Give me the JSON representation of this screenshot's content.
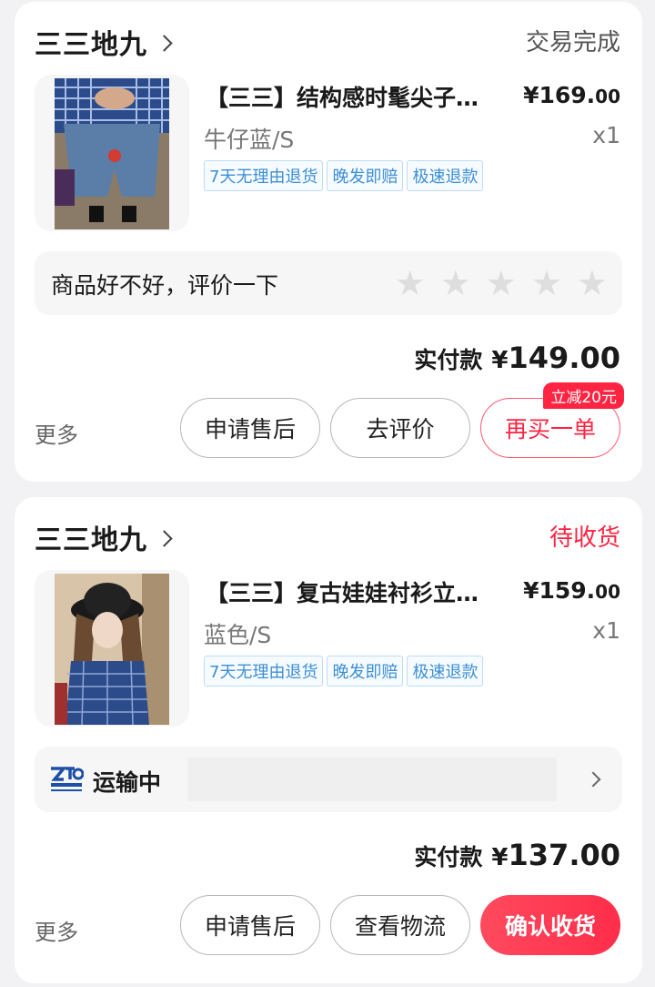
{
  "orders": [
    {
      "shop_name": "三三地九",
      "status": "交易完成",
      "product": {
        "title": "【三三】结构感时髦尖子…",
        "price_main": "¥169.",
        "price_cents": "00",
        "spec": "牛仔蓝/S",
        "qty": "x1",
        "tags": [
          "7天无理由退货",
          "晚发即赔",
          "极速退款"
        ]
      },
      "rating_prompt": "商品好不好，评价一下",
      "rating_stars": 0,
      "paid_label": "实付款",
      "paid_amount": "149.00",
      "more": "更多",
      "buttons": [
        "申请售后",
        "去评价",
        "再买一单"
      ],
      "discount_badge": "立减20元"
    },
    {
      "shop_name": "三三地九",
      "status": "待收货",
      "product": {
        "title": "【三三】复古娃娃衬衫立…",
        "price_main": "¥159.",
        "price_cents": "00",
        "spec": "蓝色/S",
        "qty": "x1",
        "tags": [
          "7天无理由退货",
          "晚发即赔",
          "极速退款"
        ]
      },
      "shipping": {
        "carrier_icon": "zto-express-logo",
        "status": "运输中"
      },
      "paid_label": "实付款",
      "paid_amount": "137.00",
      "more": "更多",
      "buttons": [
        "申请售后",
        "查看物流",
        "确认收货"
      ]
    }
  ],
  "currency": "¥",
  "colors": {
    "accent": "#ff2442",
    "tag_blue": "#3d8fd6",
    "star_empty": "#dedede"
  }
}
